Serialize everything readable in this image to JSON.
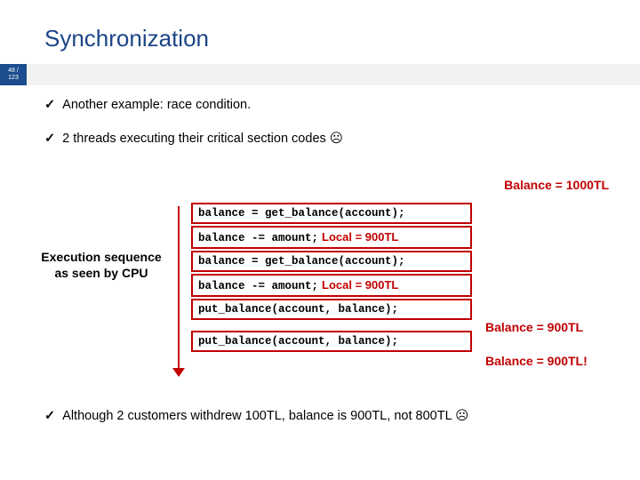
{
  "page": {
    "num": "48",
    "total": "123"
  },
  "title": "Synchronization",
  "bullets": {
    "b1": "Another example: race condition.",
    "b2": "2 threads executing their critical section codes ☹",
    "b3": "Although 2 customers withdrew 100TL, balance is 900TL, not 800TL ☹"
  },
  "balance": {
    "initial": "Balance = 1000TL",
    "after1": "Balance = 900TL",
    "after2": "Balance = 900TL!"
  },
  "exec_label_l1": "Execution sequence",
  "exec_label_l2": "as seen by CPU",
  "code": {
    "c1": "balance = get_balance(account);",
    "c2": "balance -= amount;",
    "local1": "Local = 900TL",
    "c3": "balance = get_balance(account);",
    "c4": "balance -= amount;",
    "local2": "Local = 900TL",
    "c5": "put_balance(account, balance);",
    "c6": "put_balance(account, balance);"
  }
}
